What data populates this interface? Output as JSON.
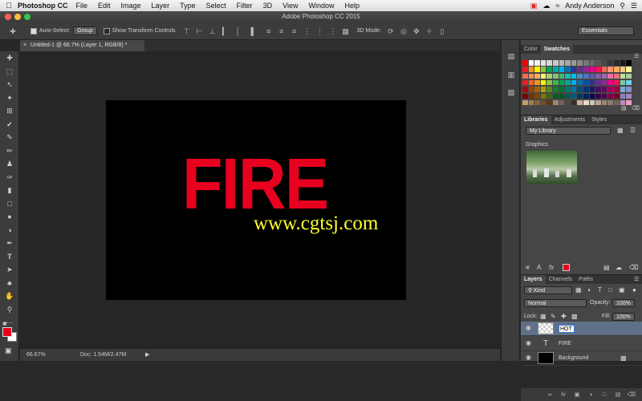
{
  "menubar": {
    "app_name": "Photoshop CC",
    "items": [
      "File",
      "Edit",
      "Image",
      "Layer",
      "Type",
      "Select",
      "Filter",
      "3D",
      "View",
      "Window",
      "Help"
    ],
    "user": "Andy Anderson"
  },
  "window": {
    "title": "Adobe Photoshop CC 2015"
  },
  "options": {
    "auto_select_label": "Auto-Select:",
    "auto_select_value": "Group",
    "show_transform_label": "Show Transform Controls",
    "mode_3d_label": "3D Mode:",
    "workspace": "Essentials"
  },
  "document": {
    "tab_label": "Untitled-1 @ 66.7% (Layer 1, RGB/8) *",
    "canvas_text": "FIRE",
    "watermark": "www.cgtsj.com",
    "zoom": "66.67%",
    "doc_info": "Doc: 1.54M/2.47M"
  },
  "swatches_panel": {
    "tabs": [
      "Color",
      "Swatches"
    ],
    "colors": [
      [
        "#ff0000",
        "#ffffff",
        "#f4f4f4",
        "#e6e6e6",
        "#d6d6d6",
        "#c8c8c8",
        "#b8b8b8",
        "#a8a8a8",
        "#989898",
        "#888888",
        "#787878",
        "#686868",
        "#585858",
        "#484848",
        "#383838",
        "#282828",
        "#181818",
        "#000000"
      ],
      [
        "#ee1c24",
        "#f7941d",
        "#fff200",
        "#8dc63f",
        "#00a651",
        "#00a99d",
        "#00aeef",
        "#0072bc",
        "#2e3192",
        "#662d91",
        "#92278f",
        "#ec008c",
        "#ed145b",
        "#f26c4f",
        "#f69679",
        "#fbaf5d",
        "#fdc689",
        "#fff799"
      ],
      [
        "#f26c4f",
        "#f68e55",
        "#fbaf5c",
        "#fff467",
        "#acd372",
        "#7cc576",
        "#3bb878",
        "#1abbb4",
        "#00bff3",
        "#438cca",
        "#5574b9",
        "#605ca8",
        "#855fa8",
        "#a763a8",
        "#f06eaa",
        "#f26d7d",
        "#c4df9b",
        "#a2d39c"
      ],
      [
        "#ed1c24",
        "#f26522",
        "#f7941d",
        "#fff200",
        "#8dc63f",
        "#39b54a",
        "#00a651",
        "#00a99d",
        "#00aeef",
        "#0072bc",
        "#0054a6",
        "#2e3192",
        "#662d91",
        "#92278f",
        "#ec008c",
        "#ed145b",
        "#82ca9c",
        "#6dcff6"
      ],
      [
        "#9e0b0f",
        "#a0410d",
        "#a3620a",
        "#aba000",
        "#598527",
        "#1a7b30",
        "#007236",
        "#00746b",
        "#0076a3",
        "#004b80",
        "#003471",
        "#1b1464",
        "#440e62",
        "#630460",
        "#9e005d",
        "#9e0039",
        "#7da7d9",
        "#8393ca"
      ],
      [
        "#790000",
        "#7b2e00",
        "#7d4900",
        "#827b00",
        "#406618",
        "#005e20",
        "#005826",
        "#005952",
        "#005b7f",
        "#003663",
        "#002157",
        "#0d004c",
        "#32004b",
        "#4b0049",
        "#7b0046",
        "#7a0026",
        "#8781bd",
        "#a187be"
      ],
      [
        "#c69c6d",
        "#a67c52",
        "#8c6239",
        "#754c24",
        "#603913",
        "#998675",
        "#736357",
        "#534741",
        "#362f2d",
        "#c7b299",
        "#e6dacd",
        "#cfc5b5",
        "#b6a28e",
        "#998675",
        "#8b7d6b",
        "#736357",
        "#bd8cbf",
        "#f49ac1"
      ]
    ]
  },
  "libraries_panel": {
    "tabs": [
      "Libraries",
      "Adjustments",
      "Styles"
    ],
    "library": "My Library",
    "section": "Graphics"
  },
  "layers_panel": {
    "tabs": [
      "Layers",
      "Channels",
      "Paths"
    ],
    "filter": "Kind",
    "blend_mode": "Normal",
    "opacity_label": "Opacity:",
    "opacity": "100%",
    "lock_label": "Lock:",
    "fill_label": "Fill:",
    "fill": "100%",
    "layers": [
      {
        "name": "HOT",
        "kind": "raster",
        "editing": true
      },
      {
        "name": "FIRE",
        "kind": "type",
        "editing": false
      },
      {
        "name": "Background",
        "kind": "background",
        "editing": false
      }
    ]
  },
  "colors": {
    "foreground": "#e8001f",
    "background": "#ffffff",
    "fire_text": "#e8001f",
    "watermark": "#ffff2a"
  }
}
